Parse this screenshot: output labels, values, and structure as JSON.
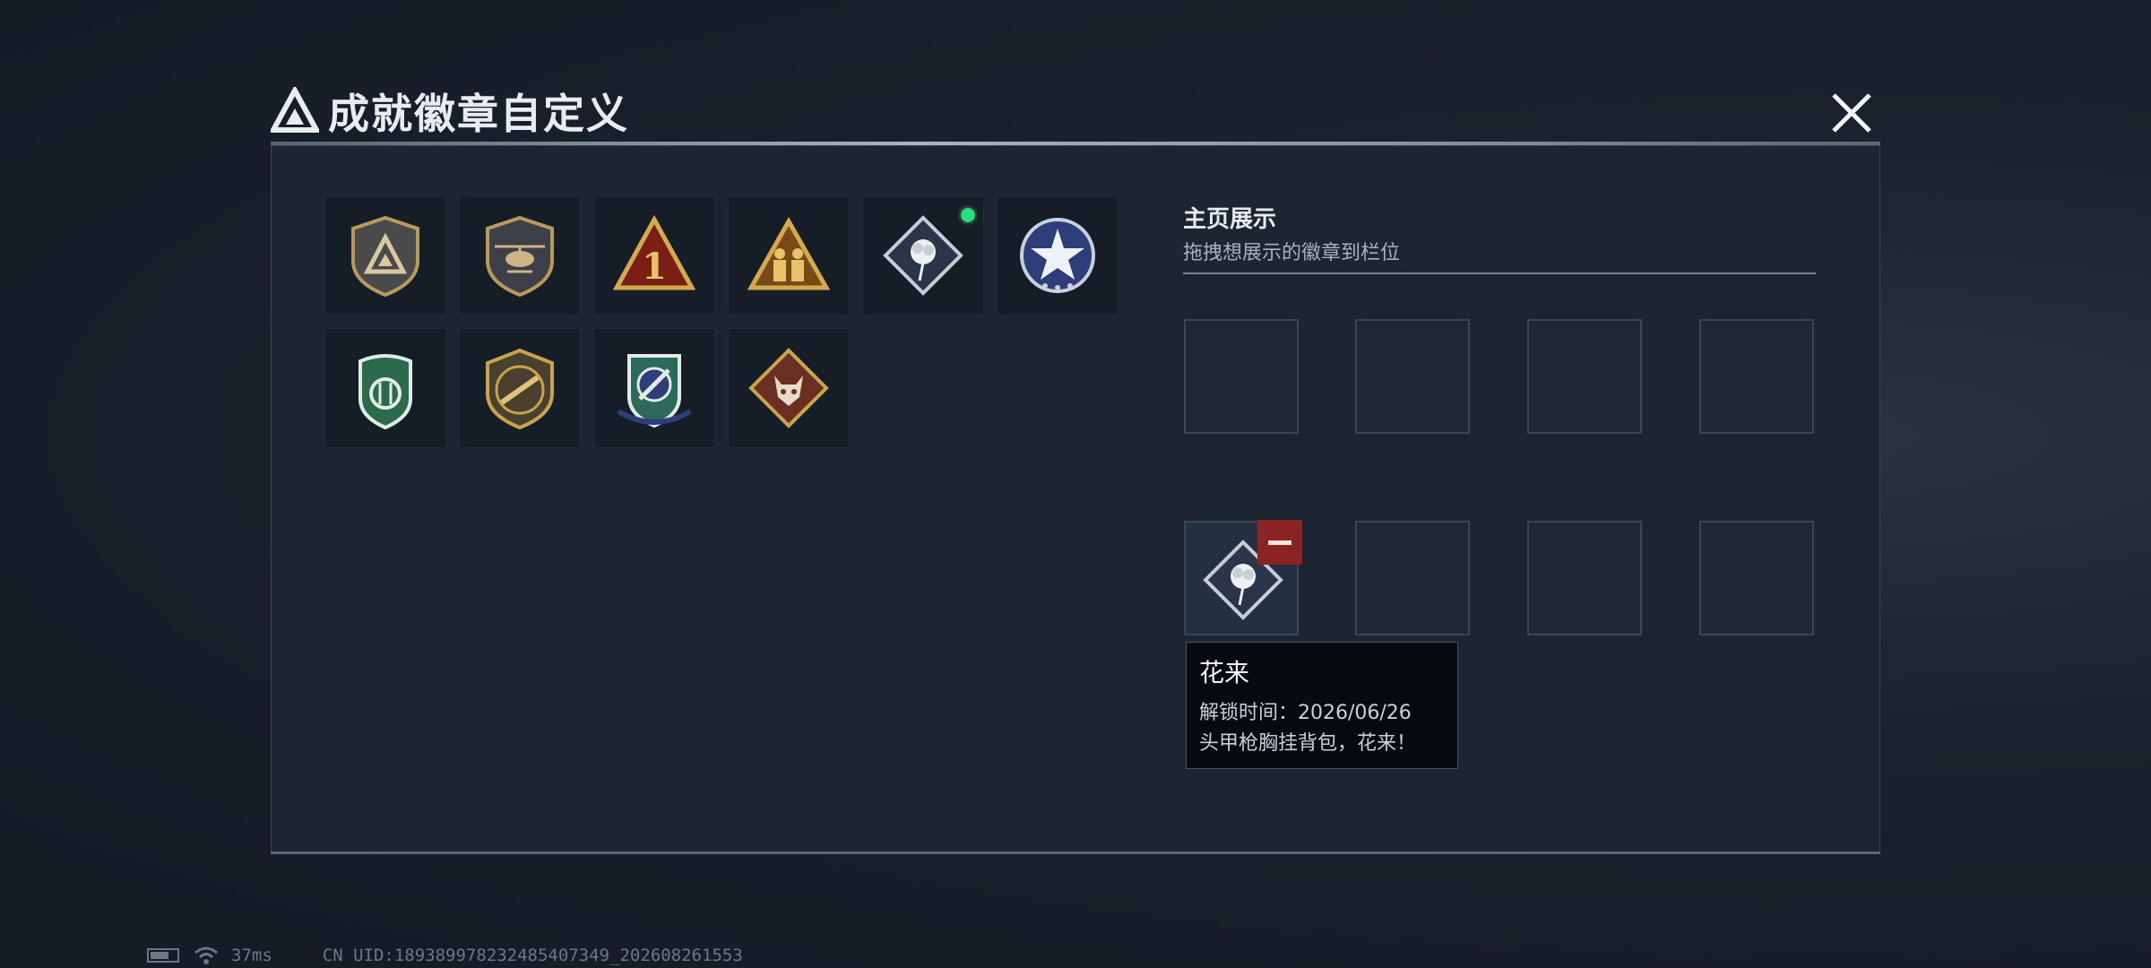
{
  "dialog": {
    "title": "成就徽章自定义"
  },
  "badges": [
    {
      "icon": "triangle-logo-shield-badge-icon",
      "new": false
    },
    {
      "icon": "helicopter-shield-badge-icon",
      "new": false
    },
    {
      "icon": "number-one-triangle-badge-icon",
      "new": false
    },
    {
      "icon": "soldiers-triangle-badge-icon",
      "new": false
    },
    {
      "icon": "flower-diamond-badge-icon",
      "new": true
    },
    {
      "icon": "star-round-badge-icon",
      "new": false
    },
    {
      "icon": "green-shield-badge-icon",
      "new": false
    },
    {
      "icon": "rifle-shield-badge-icon",
      "new": false
    },
    {
      "icon": "blue-crest-badge-icon",
      "new": false
    },
    {
      "icon": "wolf-diamond-badge-icon",
      "new": false
    }
  ],
  "showcase": {
    "title": "主页展示",
    "subtitle": "拖拽想展示的徽章到栏位",
    "filled_slot_icon": "flower-diamond-badge-icon"
  },
  "tooltip": {
    "name": "花来",
    "unlock_time": "解锁时间：2026/06/26",
    "description": "头甲枪胸挂背包，花来！"
  },
  "status": {
    "ping": "37ms",
    "uid": "CN UID:1893899782324854073­49_202608261553"
  },
  "colors": {
    "new_dot": "#22e07a",
    "remove": "#8a2424",
    "gold": "#c9a54a"
  }
}
